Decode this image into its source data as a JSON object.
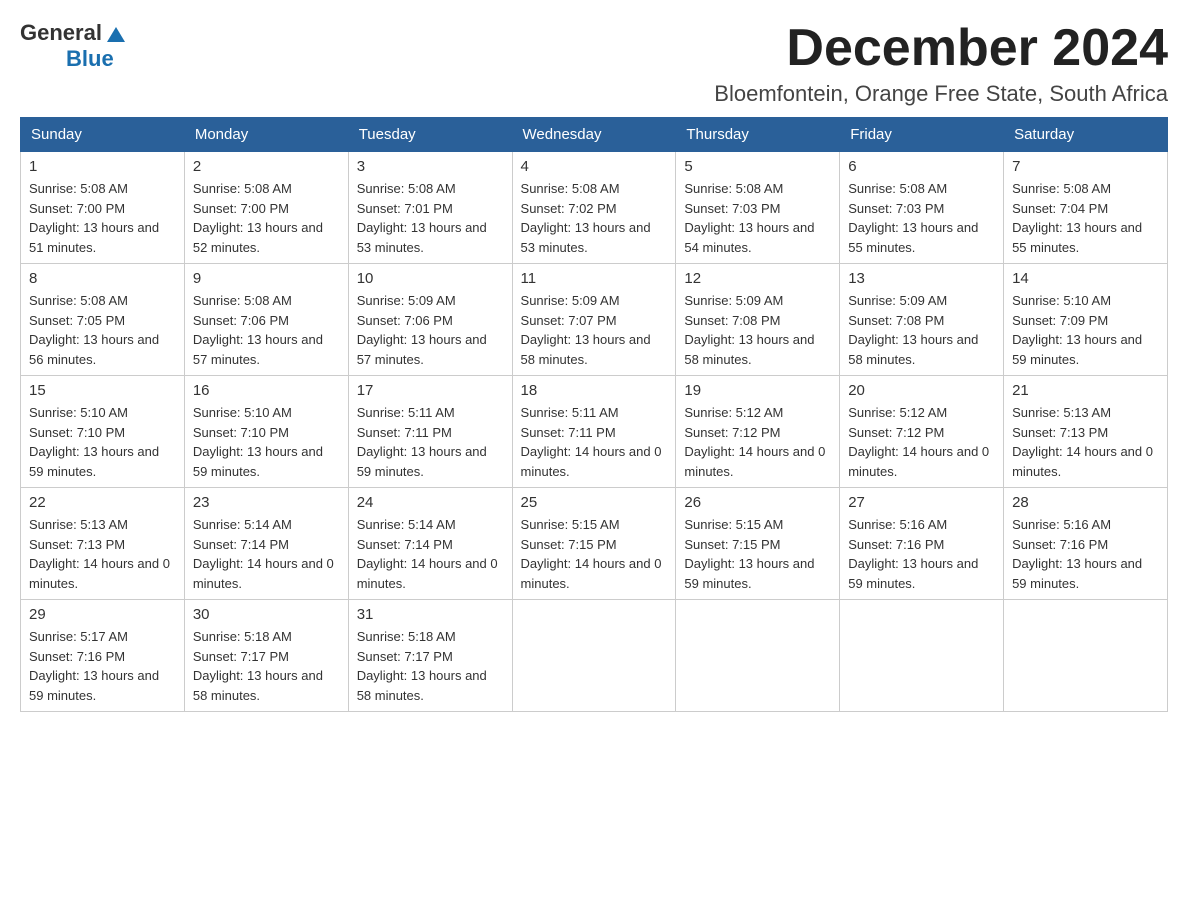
{
  "header": {
    "logo_general": "General",
    "logo_blue": "Blue",
    "month_title": "December 2024",
    "subtitle": "Bloemfontein, Orange Free State, South Africa"
  },
  "weekdays": [
    "Sunday",
    "Monday",
    "Tuesday",
    "Wednesday",
    "Thursday",
    "Friday",
    "Saturday"
  ],
  "weeks": [
    [
      {
        "day": "1",
        "sunrise": "5:08 AM",
        "sunset": "7:00 PM",
        "daylight": "13 hours and 51 minutes."
      },
      {
        "day": "2",
        "sunrise": "5:08 AM",
        "sunset": "7:00 PM",
        "daylight": "13 hours and 52 minutes."
      },
      {
        "day": "3",
        "sunrise": "5:08 AM",
        "sunset": "7:01 PM",
        "daylight": "13 hours and 53 minutes."
      },
      {
        "day": "4",
        "sunrise": "5:08 AM",
        "sunset": "7:02 PM",
        "daylight": "13 hours and 53 minutes."
      },
      {
        "day": "5",
        "sunrise": "5:08 AM",
        "sunset": "7:03 PM",
        "daylight": "13 hours and 54 minutes."
      },
      {
        "day": "6",
        "sunrise": "5:08 AM",
        "sunset": "7:03 PM",
        "daylight": "13 hours and 55 minutes."
      },
      {
        "day": "7",
        "sunrise": "5:08 AM",
        "sunset": "7:04 PM",
        "daylight": "13 hours and 55 minutes."
      }
    ],
    [
      {
        "day": "8",
        "sunrise": "5:08 AM",
        "sunset": "7:05 PM",
        "daylight": "13 hours and 56 minutes."
      },
      {
        "day": "9",
        "sunrise": "5:08 AM",
        "sunset": "7:06 PM",
        "daylight": "13 hours and 57 minutes."
      },
      {
        "day": "10",
        "sunrise": "5:09 AM",
        "sunset": "7:06 PM",
        "daylight": "13 hours and 57 minutes."
      },
      {
        "day": "11",
        "sunrise": "5:09 AM",
        "sunset": "7:07 PM",
        "daylight": "13 hours and 58 minutes."
      },
      {
        "day": "12",
        "sunrise": "5:09 AM",
        "sunset": "7:08 PM",
        "daylight": "13 hours and 58 minutes."
      },
      {
        "day": "13",
        "sunrise": "5:09 AM",
        "sunset": "7:08 PM",
        "daylight": "13 hours and 58 minutes."
      },
      {
        "day": "14",
        "sunrise": "5:10 AM",
        "sunset": "7:09 PM",
        "daylight": "13 hours and 59 minutes."
      }
    ],
    [
      {
        "day": "15",
        "sunrise": "5:10 AM",
        "sunset": "7:10 PM",
        "daylight": "13 hours and 59 minutes."
      },
      {
        "day": "16",
        "sunrise": "5:10 AM",
        "sunset": "7:10 PM",
        "daylight": "13 hours and 59 minutes."
      },
      {
        "day": "17",
        "sunrise": "5:11 AM",
        "sunset": "7:11 PM",
        "daylight": "13 hours and 59 minutes."
      },
      {
        "day": "18",
        "sunrise": "5:11 AM",
        "sunset": "7:11 PM",
        "daylight": "14 hours and 0 minutes."
      },
      {
        "day": "19",
        "sunrise": "5:12 AM",
        "sunset": "7:12 PM",
        "daylight": "14 hours and 0 minutes."
      },
      {
        "day": "20",
        "sunrise": "5:12 AM",
        "sunset": "7:12 PM",
        "daylight": "14 hours and 0 minutes."
      },
      {
        "day": "21",
        "sunrise": "5:13 AM",
        "sunset": "7:13 PM",
        "daylight": "14 hours and 0 minutes."
      }
    ],
    [
      {
        "day": "22",
        "sunrise": "5:13 AM",
        "sunset": "7:13 PM",
        "daylight": "14 hours and 0 minutes."
      },
      {
        "day": "23",
        "sunrise": "5:14 AM",
        "sunset": "7:14 PM",
        "daylight": "14 hours and 0 minutes."
      },
      {
        "day": "24",
        "sunrise": "5:14 AM",
        "sunset": "7:14 PM",
        "daylight": "14 hours and 0 minutes."
      },
      {
        "day": "25",
        "sunrise": "5:15 AM",
        "sunset": "7:15 PM",
        "daylight": "14 hours and 0 minutes."
      },
      {
        "day": "26",
        "sunrise": "5:15 AM",
        "sunset": "7:15 PM",
        "daylight": "13 hours and 59 minutes."
      },
      {
        "day": "27",
        "sunrise": "5:16 AM",
        "sunset": "7:16 PM",
        "daylight": "13 hours and 59 minutes."
      },
      {
        "day": "28",
        "sunrise": "5:16 AM",
        "sunset": "7:16 PM",
        "daylight": "13 hours and 59 minutes."
      }
    ],
    [
      {
        "day": "29",
        "sunrise": "5:17 AM",
        "sunset": "7:16 PM",
        "daylight": "13 hours and 59 minutes."
      },
      {
        "day": "30",
        "sunrise": "5:18 AM",
        "sunset": "7:17 PM",
        "daylight": "13 hours and 58 minutes."
      },
      {
        "day": "31",
        "sunrise": "5:18 AM",
        "sunset": "7:17 PM",
        "daylight": "13 hours and 58 minutes."
      },
      null,
      null,
      null,
      null
    ]
  ],
  "labels": {
    "sunrise": "Sunrise:",
    "sunset": "Sunset:",
    "daylight": "Daylight:"
  }
}
